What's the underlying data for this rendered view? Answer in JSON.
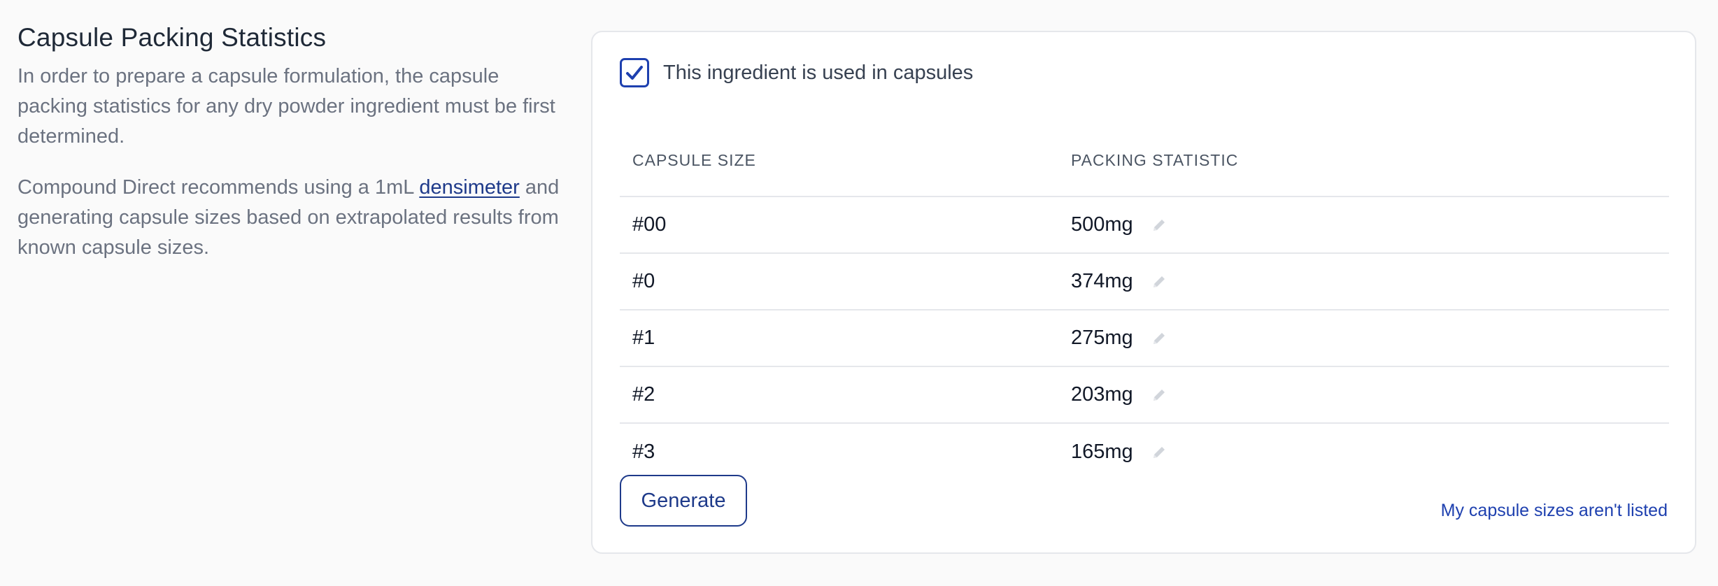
{
  "section": {
    "title": "Capsule Packing Statistics",
    "description_1": "In order to prepare a capsule formulation, the capsule packing statistics for any dry powder ingredient must be first determined.",
    "description_2_prefix": "Compound Direct recommends using a 1mL ",
    "description_2_link": "densimeter",
    "description_2_suffix": " and generating capsule sizes based on extrapolated results from known capsule sizes."
  },
  "capsules": {
    "checkbox_label": "This ingredient is used in capsules",
    "checked": true,
    "columns": [
      "CAPSULE SIZE",
      "PACKING STATISTIC"
    ],
    "rows": [
      {
        "size": "#00",
        "stat": "500mg"
      },
      {
        "size": "#0",
        "stat": "374mg"
      },
      {
        "size": "#1",
        "stat": "275mg"
      },
      {
        "size": "#2",
        "stat": "203mg"
      },
      {
        "size": "#3",
        "stat": "165mg"
      }
    ],
    "generate_label": "Generate",
    "not_listed_link": "My capsule sizes aren't listed"
  },
  "icons": {
    "checkbox": "checkmark-icon",
    "edit": "pencil-icon"
  },
  "colors": {
    "accent": "#1e40af",
    "background": "#fafafa",
    "muted_text": "#6b7280",
    "border": "#e5e7eb"
  }
}
